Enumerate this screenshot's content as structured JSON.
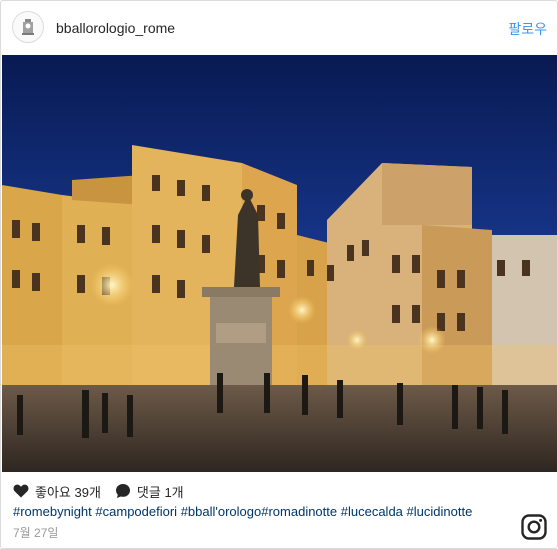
{
  "header": {
    "username": "bballorologio_rome",
    "follow_label": "팔로우"
  },
  "actions": {
    "likes_label": "좋아요 39개",
    "comments_label": "댓글 1개"
  },
  "caption": {
    "tags": [
      "#romebynight",
      "#campodefiori",
      "#bball'orologo",
      "#romadinotte",
      "#lucecalda",
      "#lucidinotte"
    ]
  },
  "date": "7월 27일",
  "icons": {
    "heart": "heart-icon",
    "comment": "comment-icon",
    "instagram": "instagram-logo-icon"
  },
  "colors": {
    "link": "#3897f0",
    "hashtag": "#003569",
    "muted": "#999999"
  }
}
